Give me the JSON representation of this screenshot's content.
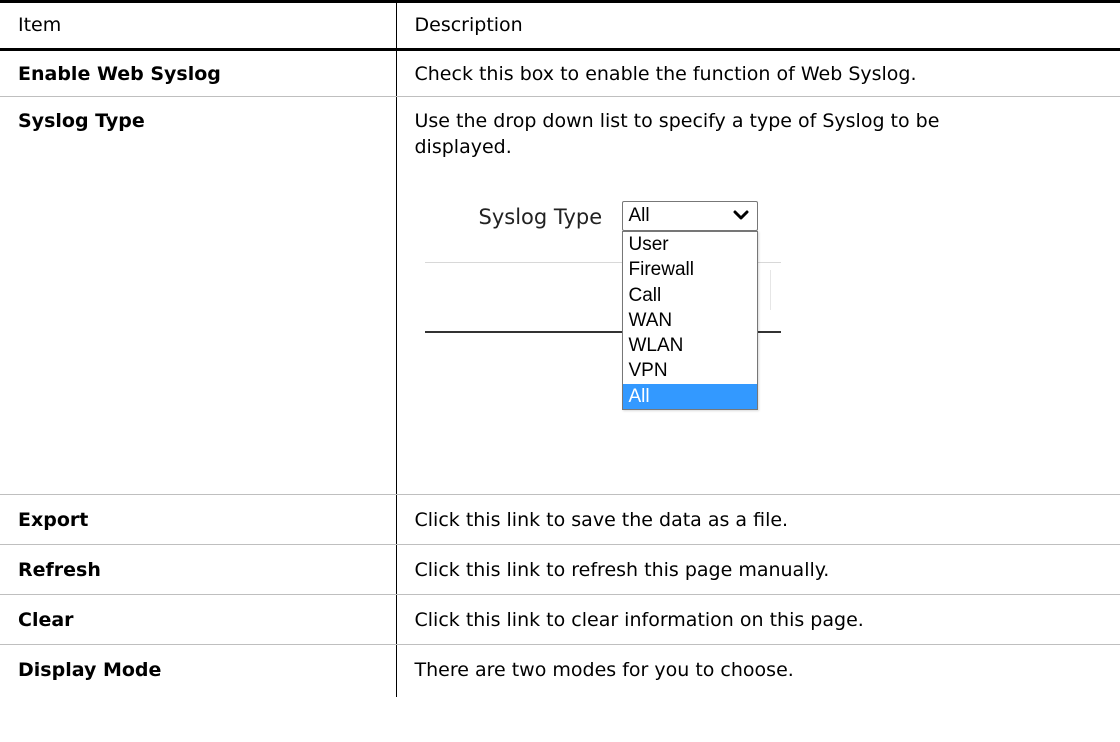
{
  "table": {
    "header": {
      "item": "Item",
      "description": "Description"
    },
    "rows": [
      {
        "item": "Enable Web Syslog",
        "description": "Check this box to enable the function of Web Syslog."
      },
      {
        "item": "Syslog Type",
        "description": "Use the drop down list to specify a type of Syslog to be displayed."
      },
      {
        "item": "Export",
        "description": "Click this link to save the data as a file."
      },
      {
        "item": "Refresh",
        "description": "Click this link to refresh this page manually."
      },
      {
        "item": "Clear",
        "description": "Click this link to clear information on this page."
      },
      {
        "item": "Display Mode",
        "description": "There are two modes for you to choose."
      }
    ]
  },
  "syslog_dropdown": {
    "label": "Syslog Type",
    "selected": "All",
    "options": [
      "User",
      "Firewall",
      "Call",
      "WAN",
      "WLAN",
      "VPN",
      "All"
    ],
    "highlighted_option": "All",
    "highlight_color": "#3399ff",
    "chevron_icon": "chevron-down-icon"
  }
}
